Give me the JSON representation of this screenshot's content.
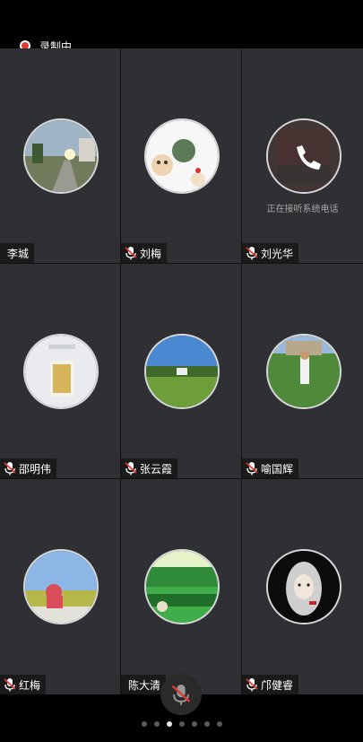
{
  "recording": {
    "label": "录制中"
  },
  "participants": [
    {
      "name": "李城",
      "muted": false,
      "status": ""
    },
    {
      "name": "刘梅",
      "muted": true,
      "status": ""
    },
    {
      "name": "刘光华",
      "muted": true,
      "status": "正在接听系统电话"
    },
    {
      "name": "邵明伟",
      "muted": true,
      "status": ""
    },
    {
      "name": "张云霞",
      "muted": true,
      "status": ""
    },
    {
      "name": "喻国辉",
      "muted": true,
      "status": ""
    },
    {
      "name": "红梅",
      "muted": true,
      "status": ""
    },
    {
      "name": "陈大清",
      "muted": false,
      "status": ""
    },
    {
      "name": "邝健睿",
      "muted": true,
      "status": ""
    }
  ],
  "pagination": {
    "total": 7,
    "current": 2
  },
  "colors": {
    "tile": "#2f3033",
    "record": "#e53935",
    "muted_mic": "#e53935"
  }
}
